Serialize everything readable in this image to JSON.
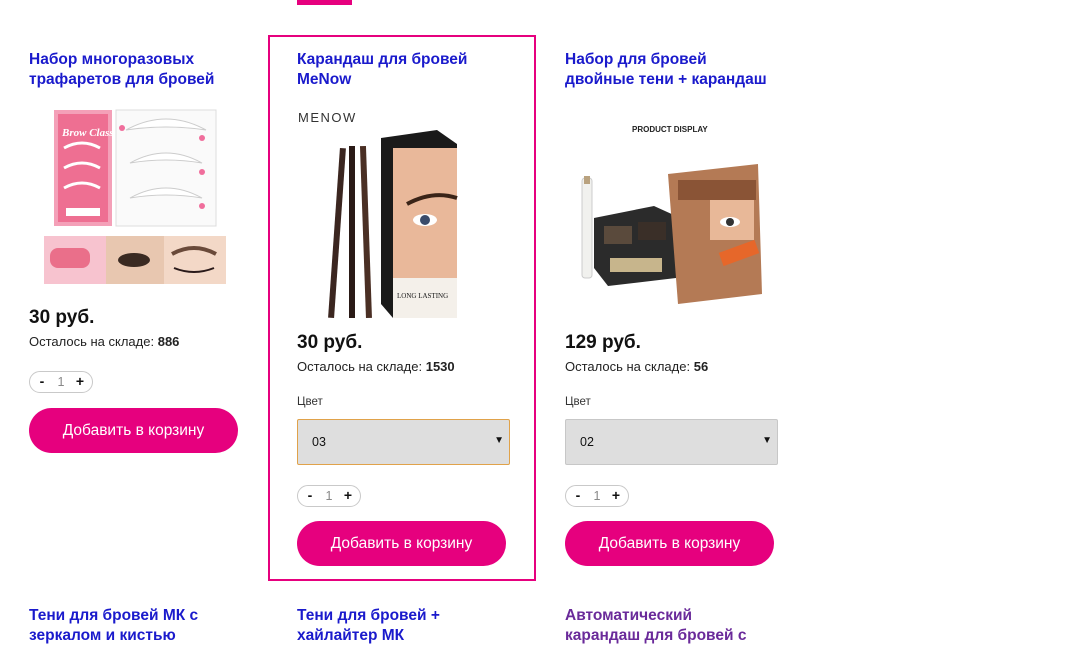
{
  "products": [
    {
      "title_line1": "Набор многоразовых",
      "title_line2": "трафаретов для бровей",
      "price": "30 руб.",
      "stock_label": "Осталось на складе:",
      "stock_value": "886",
      "qty": "1",
      "minus": "-",
      "plus": "+",
      "add_to_cart": "Добавить в корзину",
      "image_text": "Brow Class"
    },
    {
      "title_line1": "Карандаш для бровей",
      "title_line2": "MeNow",
      "price": "30 руб.",
      "stock_label": "Осталось на складе:",
      "stock_value": "1530",
      "color_label": "Цвет",
      "color_value": "03",
      "qty": "1",
      "minus": "-",
      "plus": "+",
      "add_to_cart": "Добавить в корзину",
      "image_brand": "MENOW",
      "image_text": "LONG LASTING"
    },
    {
      "title_line1": "Набор для бровей",
      "title_line2": "двойные тени + карандаш",
      "price": "129 руб.",
      "stock_label": "Осталось на складе:",
      "stock_value": "56",
      "color_label": "Цвет",
      "color_value": "02",
      "qty": "1",
      "minus": "-",
      "plus": "+",
      "add_to_cart": "Добавить в корзину",
      "image_caption": "PRODUCT DISPLAY"
    }
  ],
  "next_row": [
    {
      "title_line1": "Тени для бровей МК с",
      "title_line2": "зеркалом и кистью"
    },
    {
      "title_line1": "Тени для бровей +",
      "title_line2": "хайлайтер МК"
    },
    {
      "title_line1": "Автоматический",
      "title_line2": "карандаш для бровей с"
    }
  ],
  "colors": {
    "accent": "#e6007e",
    "link": "#1a1acc",
    "visited_link": "#6a2a9a",
    "select_bg": "#dedede"
  },
  "icons": {
    "dropdown": "triangle-down-icon"
  }
}
